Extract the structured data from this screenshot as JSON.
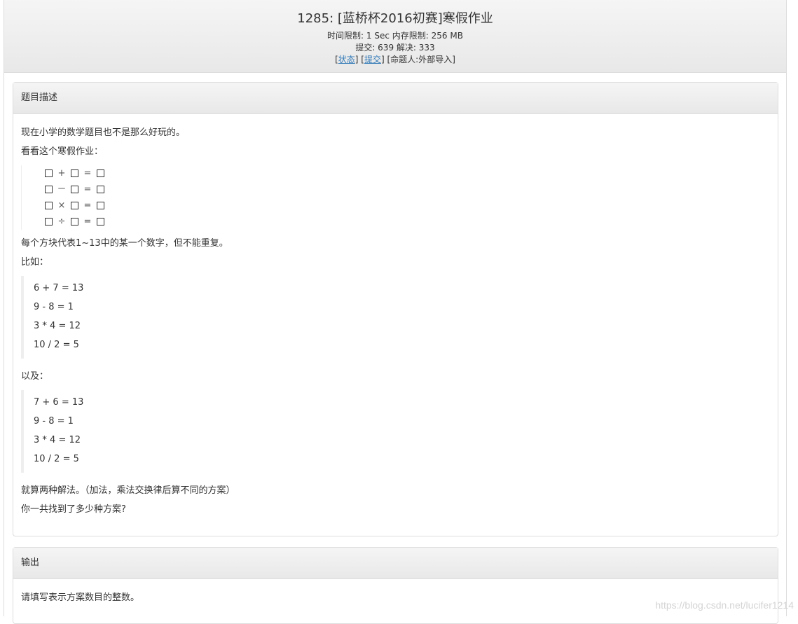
{
  "header": {
    "title": "1285: [蓝桥杯2016初赛]寒假作业",
    "time_limit": "时间限制: 1 Sec  内存限制: 256 MB",
    "stats": "提交: 639  解决: 333",
    "link_status": "状态",
    "link_submit": "提交",
    "author": "[命题人:外部导入]"
  },
  "description": {
    "heading": "题目描述",
    "line1": "现在小学的数学题目也不是那么好玩的。",
    "line2": "看看这个寒假作业：",
    "equations": [
      {
        "op": "+",
        "eq": "="
      },
      {
        "op": "－",
        "eq": "="
      },
      {
        "op": "×",
        "eq": "="
      },
      {
        "op": "÷",
        "eq": "="
      }
    ],
    "line3": "每个方块代表1~13中的某一个数字，但不能重复。",
    "line4": "比如：",
    "example1": [
      "6  + 7 = 13",
      "9  - 8 = 1",
      "3  * 4 = 12",
      "10 / 2 = 5"
    ],
    "line5": "以及：",
    "example2": [
      "7  + 6 = 13",
      "9  - 8 = 1",
      "3 * 4 = 12",
      "10 / 2 = 5"
    ],
    "line6": "就算两种解法。（加法，乘法交换律后算不同的方案）",
    "line7": "你一共找到了多少种方案?"
  },
  "output": {
    "heading": "输出",
    "text": "请填写表示方案数目的整数。"
  },
  "watermark": "https://blog.csdn.net/lucifer1214"
}
